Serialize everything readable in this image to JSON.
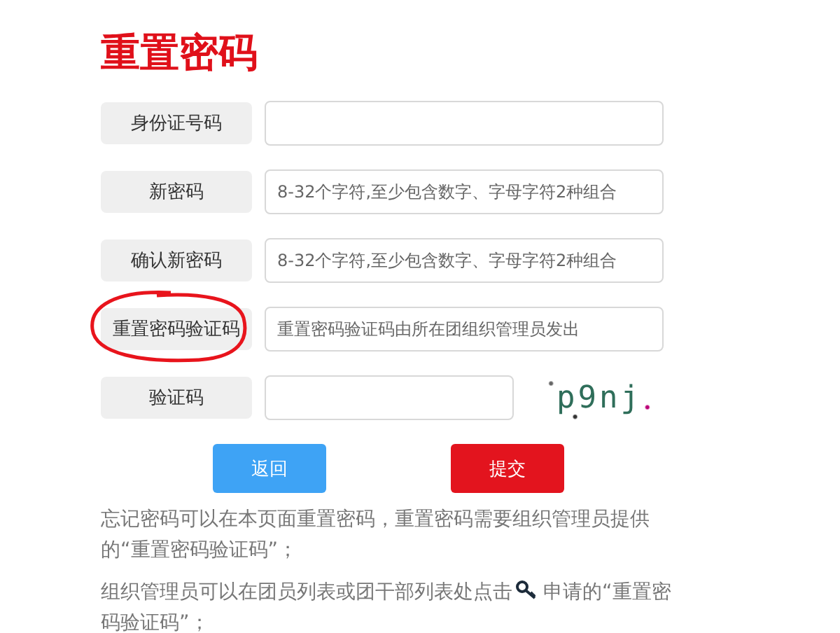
{
  "title": "重置密码",
  "fields": [
    {
      "label": "身份证号码",
      "kind": "text",
      "circled": false
    },
    {
      "label": "新密码",
      "kind": "text",
      "placeholder": "8-32个字符,至少包含数字、字母字符2种组合",
      "circled": false
    },
    {
      "label": "确认新密码",
      "kind": "text",
      "placeholder": "8-32个字符,至少包含数字、字母字符2种组合",
      "circled": false
    },
    {
      "label": "重置密码验证码",
      "kind": "text",
      "placeholder": "重置密码验证码由所在团组织管理员发出",
      "circled": true
    },
    {
      "label": "验证码",
      "kind": "captcha",
      "captcha": "p9nj",
      "circled": false
    }
  ],
  "buttons": [
    {
      "label": "返回",
      "kind": "back"
    },
    {
      "label": "提交",
      "kind": "submit"
    }
  ],
  "notes": [
    {
      "before": "忘记密码可以在本页面重置密码，重置密码需要组织管理员提供的“重置密码验证码”；",
      "icon": false
    },
    {
      "before": "组织管理员可以在团员列表或团干部列表处点击",
      "icon": true,
      "after": "申请的“重置密码验证码”；"
    }
  ]
}
